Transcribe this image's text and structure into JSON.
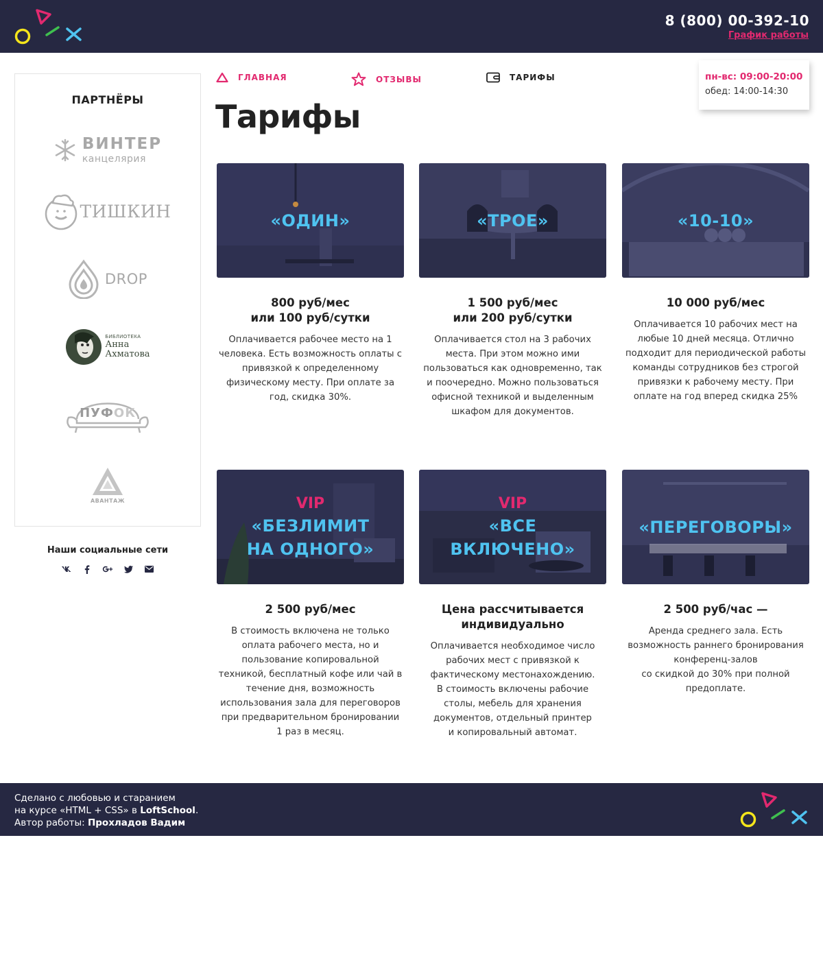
{
  "header": {
    "phone": "8 (800) 00-392-10",
    "schedule_link": "График работы"
  },
  "hours": {
    "main": "пн-вс: 09:00-20:00",
    "lunch": "обед: 14:00-14:30"
  },
  "nav": [
    {
      "label": "ГЛАВНАЯ",
      "icon": "triangle-icon"
    },
    {
      "label": "ОТЗЫВЫ",
      "icon": "star-icon"
    },
    {
      "label": "ТАРИФЫ",
      "icon": "wallet-icon"
    }
  ],
  "page_title": "Тарифы",
  "sidebar": {
    "title": "ПАРТНЁРЫ",
    "partners": {
      "winter": {
        "name": "ВИНТЕР",
        "sub": "канцелярия"
      },
      "tishkin": {
        "name": "ТИШКИН"
      },
      "drop": {
        "name": "DROP"
      },
      "akhmatova": {
        "top": "БИБЛИОТЕКА",
        "name1": "Анна",
        "name2": "Ахматова"
      },
      "pufok": {
        "name1": "ПУФ",
        "name2": "ОК"
      },
      "avantazh": {
        "name": "АВАНТАЖ"
      }
    },
    "social_title": "Наши социальные сети",
    "social": [
      "vk-icon",
      "facebook-icon",
      "google-plus-icon",
      "twitter-icon",
      "mail-icon"
    ]
  },
  "tariffs": [
    {
      "vip": "",
      "name1": "«ОДИН»",
      "name2": "",
      "price1": "800 руб/мес",
      "price2": "или 100 руб/сутки",
      "desc": [
        "Оплачивается рабочее место на 1",
        "человека. Есть возможность оплаты с",
        "привязкой к определенному",
        "физическому месту. При оплате за",
        "год, скидка 30%."
      ]
    },
    {
      "vip": "",
      "name1": "«ТРОЕ»",
      "name2": "",
      "price1": "1 500 руб/мес",
      "price2": "или 200 руб/сутки",
      "desc": [
        "Оплачивается стол на 3 рабочих",
        "места. При этом можно ими",
        "пользоваться как одновременно, так",
        "и поочередно. Можно пользоваться",
        "офисной техникой и выделенным",
        "шкафом для документов."
      ]
    },
    {
      "vip": "",
      "name1": "«10-10»",
      "name2": "",
      "price1": "10 000 руб/мес",
      "price2": "",
      "desc": [
        "Оплачивается 10 рабочих мест на",
        "любые 10 дней месяца. Отлично",
        "подходит для периодической работы",
        "команды сотрудников без строгой",
        "привязки к рабочему месту. При",
        "оплате на год вперед скидка 25%"
      ]
    },
    {
      "vip": "VIP",
      "name1": "«БЕЗЛИМИТ",
      "name2": "НА ОДНОГО»",
      "price1": "2 500 руб/мес",
      "price2": "",
      "desc": [
        "В стоимость включена не только",
        "оплата рабочего места, но и",
        "пользование копировальной",
        "техникой, бесплатный кофе или чай в",
        "течение дня, возможность",
        "использования зала для переговоров",
        "при предварительном бронировании",
        "1 раз в месяц."
      ]
    },
    {
      "vip": "VIP",
      "name1": "«ВСЕ",
      "name2": "ВКЛЮЧЕНО»",
      "price1": "Цена рассчитывается",
      "price2": "индивидуально",
      "desc": [
        "Оплачивается необходимое число",
        "рабочих мест с привязкой к",
        "фактическому местонахождению.",
        "В стоимость включены рабочие",
        "столы, мебель для хранения",
        "документов, отдельный принтер",
        "и копировальный автомат."
      ]
    },
    {
      "vip": "",
      "name1": "«ПЕРЕГОВОРЫ»",
      "name2": "",
      "price1": "2 500 руб/час —",
      "price2": "",
      "desc": [
        "Аренда среднего зала. Есть",
        "возможность раннего бронирования",
        "конференц-залов",
        "со скидкой до 30% при полной",
        "предоплате."
      ]
    }
  ],
  "footer": {
    "line1": "Сделано с любовью и старанием",
    "line2_pre": "на курсе «HTML + CSS» в ",
    "line2_bold": "LoftSchool",
    "line2_post": ".",
    "line3_pre": "Автор работы: ",
    "line3_bold": "Прохладов Вадим"
  },
  "colors": {
    "dark": "#262842",
    "pink": "#e2296f",
    "blue": "#4fc3f0",
    "yellow": "#f5e51b",
    "green": "#3fbf4f"
  }
}
